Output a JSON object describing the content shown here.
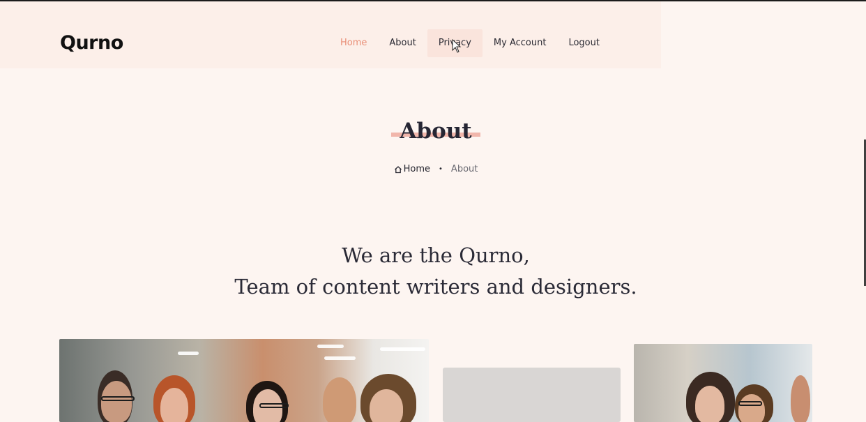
{
  "brand": {
    "logo_text": "Qurno"
  },
  "nav": {
    "items": [
      {
        "label": "Home",
        "state": "active"
      },
      {
        "label": "About",
        "state": "normal"
      },
      {
        "label": "Privacy",
        "state": "hover"
      },
      {
        "label": "My Account",
        "state": "normal"
      },
      {
        "label": "Logout",
        "state": "normal"
      }
    ]
  },
  "page": {
    "title": "About",
    "breadcrumb": {
      "home_label": "Home",
      "separator": "•",
      "current": "About"
    }
  },
  "headline": {
    "line1": "We are the Qurno,",
    "line2": "Team of content writers and designers."
  },
  "icons": {
    "home": "home-icon",
    "cursor": "mouse-cursor-icon"
  },
  "colors": {
    "background": "#fdf5f1",
    "header_bg": "#fcefe9",
    "accent": "#e98e76",
    "title_underline": "#f1b6ab",
    "text": "#222230"
  }
}
